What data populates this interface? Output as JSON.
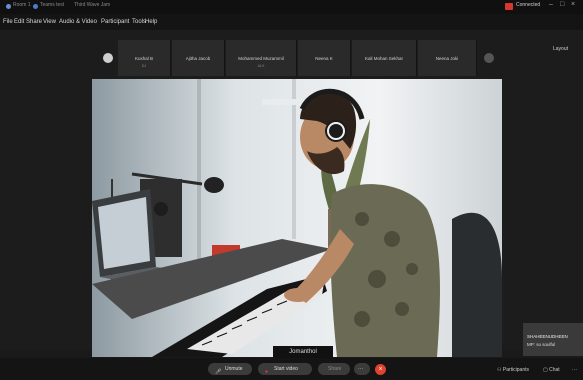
{
  "titlebar": {
    "app_label": "Room 1",
    "tab1": "Teams test",
    "tab2": "Third Wave Jam",
    "recording_label": "Connected",
    "minimize": "–",
    "maximize": "□",
    "close": "×"
  },
  "menu": [
    "File",
    "Edit",
    "Share",
    "View",
    "Audio & Video",
    "Participant",
    "Tools",
    "Help"
  ],
  "participants_strip": [
    {
      "name": "Kushal B",
      "sub": "DJ"
    },
    {
      "name": "Ajitha Jacob",
      "sub": ""
    },
    {
      "name": "Mohammed Muzammil",
      "sub": "ULK"
    },
    {
      "name": "Neena K",
      "sub": ""
    },
    {
      "name": "Kali Mohan Sekhar",
      "sub": ""
    },
    {
      "name": "Neena Joki",
      "sub": ""
    }
  ],
  "layout_button": "Layout",
  "main_speaker": "Jomanthol",
  "pinned": {
    "name": "SHAHEENUDHEEN",
    "message": "MP: so soulful"
  },
  "toolbar": {
    "unmute": "Unmute",
    "start_video": "Start video",
    "share": "Share",
    "more": "···",
    "end": "×",
    "participants": "Participants",
    "chat": "Chat",
    "overflow": "···"
  },
  "colors": {
    "accent_red": "#e0432e",
    "bg": "#1a1a1a"
  }
}
